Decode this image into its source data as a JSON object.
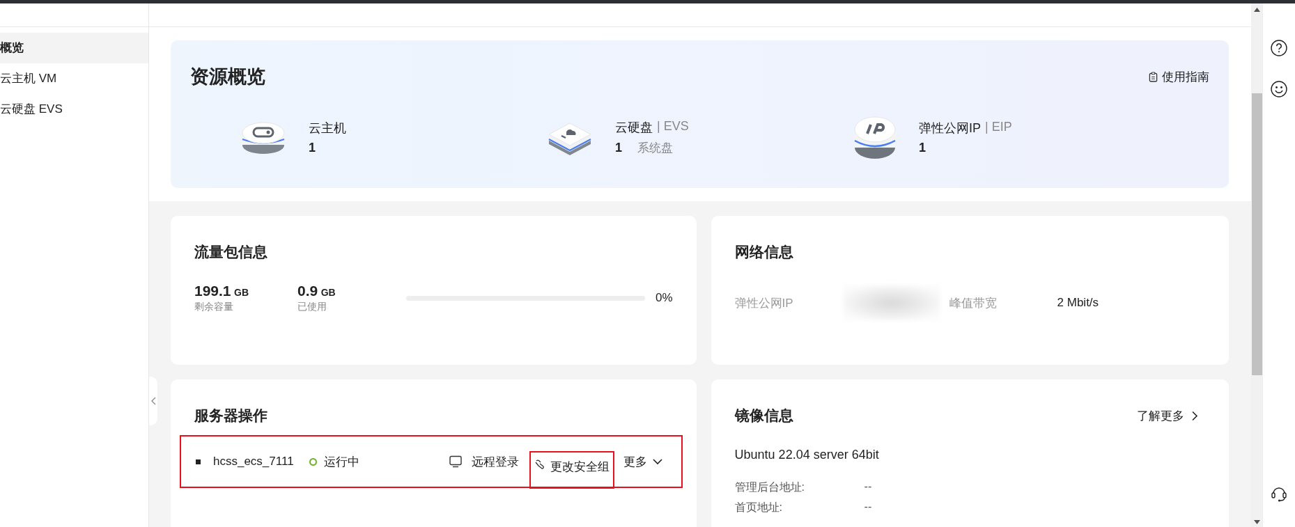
{
  "sidebar": {
    "items": [
      {
        "label": "概览",
        "selected": true
      },
      {
        "label": "云主机 VM",
        "selected": false
      },
      {
        "label": "云硬盘 EVS",
        "selected": false
      }
    ]
  },
  "overview": {
    "title": "资源概览",
    "guide_link": "使用指南",
    "resources": [
      {
        "kind": "vm",
        "name": "云主机",
        "count": "1"
      },
      {
        "kind": "disk",
        "name": "云硬盘",
        "tag": "| EVS",
        "count": "1",
        "note": "系统盘"
      },
      {
        "kind": "ip",
        "name": "弹性公网IP",
        "tag": "| EIP",
        "count": "1"
      }
    ]
  },
  "traffic": {
    "title": "流量包信息",
    "stats": [
      {
        "value": "199.1",
        "unit": "GB",
        "label": "剩余容量"
      },
      {
        "value": "0.9",
        "unit": "GB",
        "label": "已使用"
      }
    ],
    "level": 0,
    "percent": "0%"
  },
  "network": {
    "title": "网络信息",
    "fields": [
      {
        "label": "弹性公网IP",
        "redacted": true
      },
      {
        "label": "峰值带宽",
        "value": "2 Mbit/s",
        "redacted": false
      }
    ]
  },
  "server": {
    "title": "服务器操作",
    "highlighted": true,
    "name": "hcss_ecs_7111",
    "status": "运行中",
    "running": true,
    "actions": [
      {
        "kind": "remote",
        "label": "远程登录",
        "highlighted": false
      },
      {
        "kind": "security",
        "label": "更改安全组",
        "highlighted": true
      },
      {
        "kind": "more",
        "label": "更多",
        "highlighted": false
      }
    ]
  },
  "image": {
    "title": "镜像信息",
    "more_link": "了解更多",
    "os": "Ubuntu 22.04 server 64bit",
    "fields": [
      {
        "label": "管理后台地址:",
        "value": "--"
      },
      {
        "label": "首页地址:",
        "value": "--"
      }
    ]
  }
}
